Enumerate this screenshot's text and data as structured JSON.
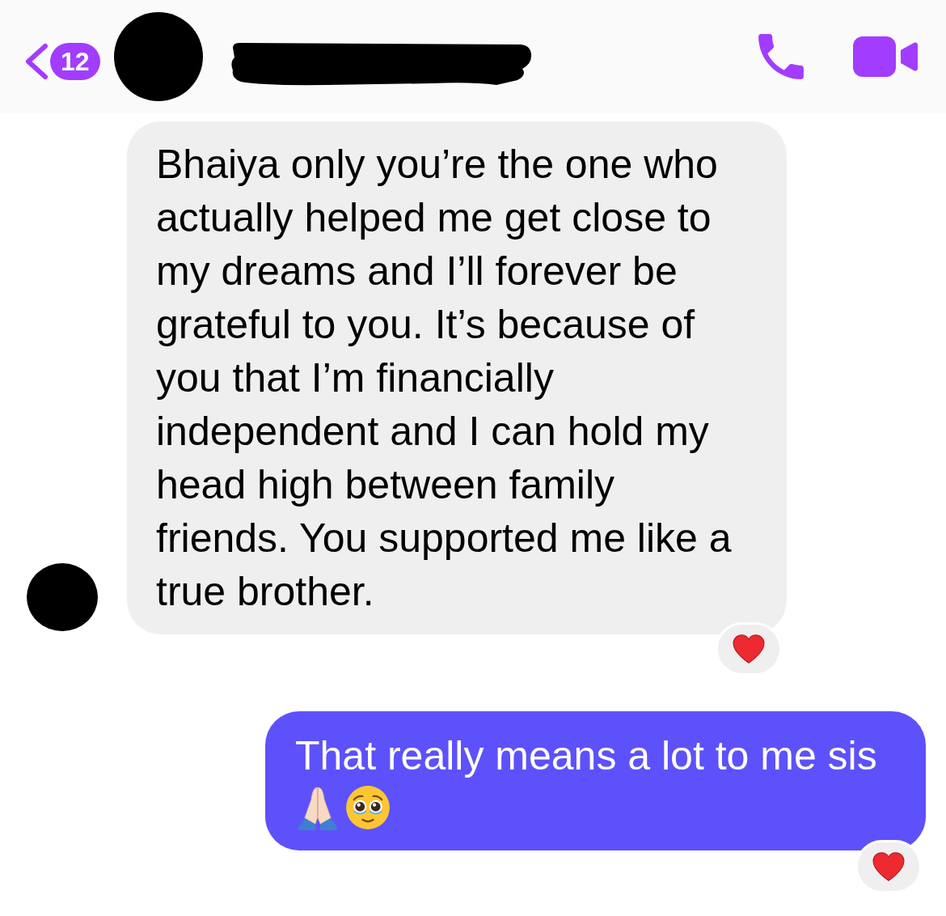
{
  "header": {
    "back": {
      "unread_count": "12"
    },
    "contact": {
      "name_redacted": true
    },
    "actions": [
      {
        "kind": "call"
      },
      {
        "kind": "video"
      }
    ]
  },
  "messages": [
    {
      "sent": false,
      "avatar": true,
      "text": "Bhaiya only you’re the one who actually helped me get close to my dreams and I’ll forever be grateful to you. It’s because of you that I’m financially independent and I can hold my head high between family friends. You supported me like a true brother.",
      "reactions": [
        {
          "kind": "heart"
        }
      ]
    },
    {
      "sent": true,
      "avatar": false,
      "text": "That really means a lot to me sis",
      "emojis": [
        {
          "kind": "praying-hands"
        },
        {
          "kind": "tearful-face"
        }
      ],
      "reactions": [
        {
          "kind": "heart"
        }
      ]
    }
  ]
}
